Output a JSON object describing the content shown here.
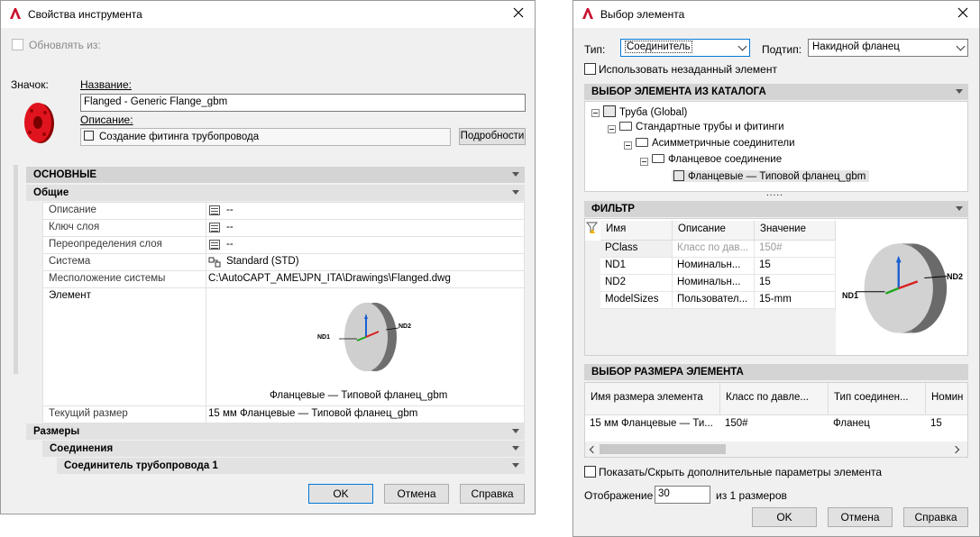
{
  "left_dialog": {
    "title": "Свойства инструмента",
    "update_from": "Обновлять из:",
    "icon_label": "Значок:",
    "name_label": "Название:",
    "name_value": "Flanged - Generic Flange_gbm",
    "desc_label": "Описание:",
    "desc_value": "Создание фитинга трубопровода",
    "details_button": "Подробности",
    "sections": {
      "main": "ОСНОВНЫЕ",
      "general": "Общие",
      "sizes": "Размеры",
      "connections": "Соединения",
      "connector": "Соединитель трубопровода 1"
    },
    "props": [
      {
        "label": "Описание",
        "value": "--"
      },
      {
        "label": "Ключ слоя",
        "value": "--"
      },
      {
        "label": "Переопределения слоя",
        "value": "--"
      },
      {
        "label": "Система",
        "value": "Standard (STD)"
      },
      {
        "label": "Месположение системы",
        "value": "C:\\AutoCAPT_AME\\JPN_ITA\\Drawings\\Flanged.dwg"
      }
    ],
    "element_label": "Элемент",
    "preview_caption": "Фланцевые — Типовой фланец_gbm",
    "nd1": "ND1",
    "nd2": "ND2",
    "current_size_label": "Текущий размер",
    "current_size_value": "15 мм Фланцевые — Типовой фланец_gbm",
    "ok": "OK",
    "cancel": "Отмена",
    "help": "Справка"
  },
  "right_dialog": {
    "title": "Выбор элемента",
    "type_label": "Тип:",
    "type_value": "Соединитель",
    "subtype_label": "Подтип:",
    "subtype_value": "Накидной фланец",
    "use_unassigned": "Использовать незаданный элемент",
    "catalog_header": "ВЫБОР ЭЛЕМЕНТА ИЗ КАТАЛОГА",
    "tree": [
      "Труба (Global)",
      "Стандартные трубы и фитинги",
      "Асимметричные соединители",
      "Фланцевое соединение",
      "Фланцевые — Типовой фланец_gbm"
    ],
    "splitter": ".....",
    "filter_header": "ФИЛЬТР",
    "filter_cols": [
      "Имя",
      "Описание",
      "Значение"
    ],
    "filter_rows": [
      {
        "name": "PClass",
        "desc": "Класс по дав...",
        "value": "150#"
      },
      {
        "name": "ND1",
        "desc": "Номинальн...",
        "value": "15"
      },
      {
        "name": "ND2",
        "desc": "Номинальн...",
        "value": "15"
      },
      {
        "name": "ModelSizes",
        "desc": "Пользовател...",
        "value": "15-mm"
      }
    ],
    "nd1": "ND1",
    "nd2": "ND2",
    "size_header": "ВЫБОР РАЗМЕРА ЭЛЕМЕНТА",
    "size_cols": [
      "Имя размера элемента",
      "Класс по давле...",
      "Тип соединен...",
      "Номин"
    ],
    "size_rows": [
      [
        "15 мм Фланцевые — Ти...",
        "150#",
        "Фланец",
        "15"
      ]
    ],
    "show_hide": "Показать/Скрыть дополнительные параметры элемента",
    "display_label": "Отображение",
    "display_value": "30",
    "display_suffix": "из 1 размеров",
    "ok": "OK",
    "cancel": "Отмена",
    "help": "Справка"
  },
  "colors": {
    "accent_red": "#c8102e",
    "section_bg": "#d4d4d4",
    "focus_blue": "#0078d7"
  }
}
